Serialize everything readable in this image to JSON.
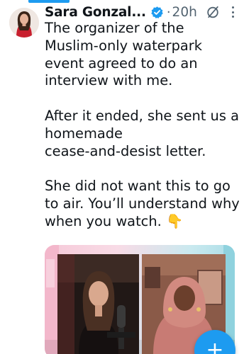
{
  "colors": {
    "accent": "#1d9bf0",
    "text": "#0f1419",
    "secondary_text": "#536471"
  },
  "author": {
    "display_name": "Sara Gonzal...",
    "verified_icon": "verified-badge-icon",
    "timestamp": "20h",
    "separator": "·"
  },
  "actions": {
    "grok_icon": "grok-icon",
    "more_icon": "more-options-icon"
  },
  "tweet": {
    "text": "The organizer of the Muslim-only waterpark event agreed to do an interview with me.\n\nAfter it ended, she sent us a homemade\ncease-and-desist letter.\n\nShe did not want this to go to air. You’ll understand why when you watch. 👇"
  },
  "compose": {
    "label": "+"
  }
}
